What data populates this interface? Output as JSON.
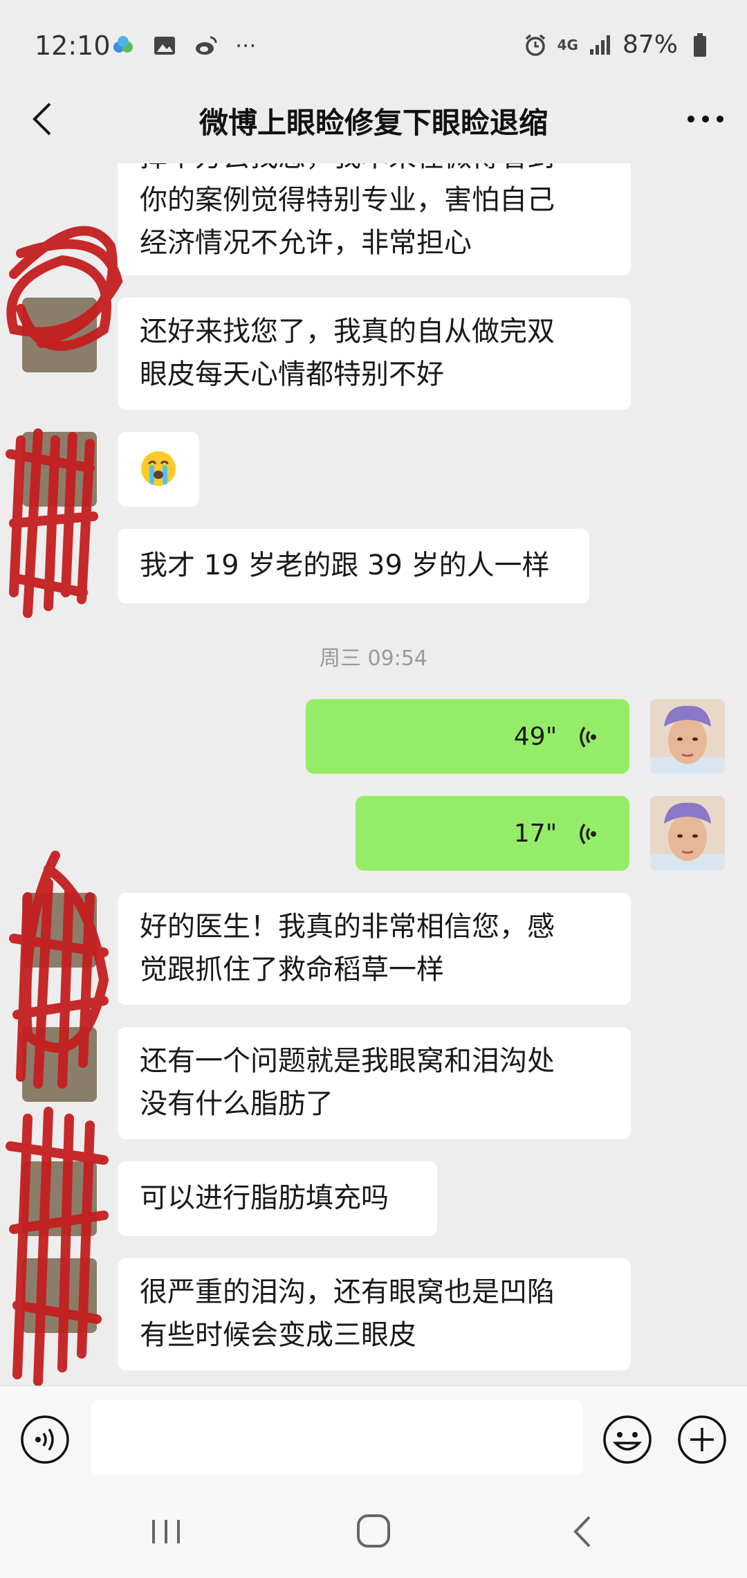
{
  "status_bar": {
    "time": "12:10",
    "network": "4G",
    "battery": "87%",
    "more": "···"
  },
  "header": {
    "title": "微博上眼睑修复下眼睑退缩"
  },
  "messages": [
    {
      "side": "left",
      "lines": [
        "择个方去找您，我本来在微博看到",
        "你的案例觉得特别专业，害怕自己",
        "经济情况不允许，非常担心"
      ]
    },
    {
      "side": "left",
      "lines": [
        "还好来找您了，我真的自从做完双",
        "眼皮每天心情都特别不好"
      ]
    },
    {
      "side": "left",
      "type": "emoji",
      "icon": "crying-face-emoji"
    },
    {
      "side": "left",
      "lines": [
        "我才 19 岁老的跟 39 岁的人一样"
      ]
    },
    {
      "type": "timestamp",
      "text": "周三 09:54"
    },
    {
      "side": "right",
      "type": "voice",
      "duration": "49\""
    },
    {
      "side": "right",
      "type": "voice",
      "duration": "17\""
    },
    {
      "side": "left",
      "lines": [
        "好的医生！我真的非常相信您，感",
        "觉跟抓住了救命稻草一样"
      ]
    },
    {
      "side": "left",
      "lines": [
        "还有一个问题就是我眼窝和泪沟处",
        "没有什么脂肪了"
      ]
    },
    {
      "side": "left",
      "lines": [
        "可以进行脂肪填充吗"
      ]
    },
    {
      "side": "left",
      "lines": [
        "很严重的泪沟，还有眼窝也是凹陷",
        "有些时候会变成三眼皮"
      ]
    }
  ],
  "input": {
    "placeholder": ""
  },
  "colors": {
    "background": "#ededed",
    "bubble_in": "#ffffff",
    "bubble_out": "#95ec69",
    "scribble": "#c41f1f"
  }
}
